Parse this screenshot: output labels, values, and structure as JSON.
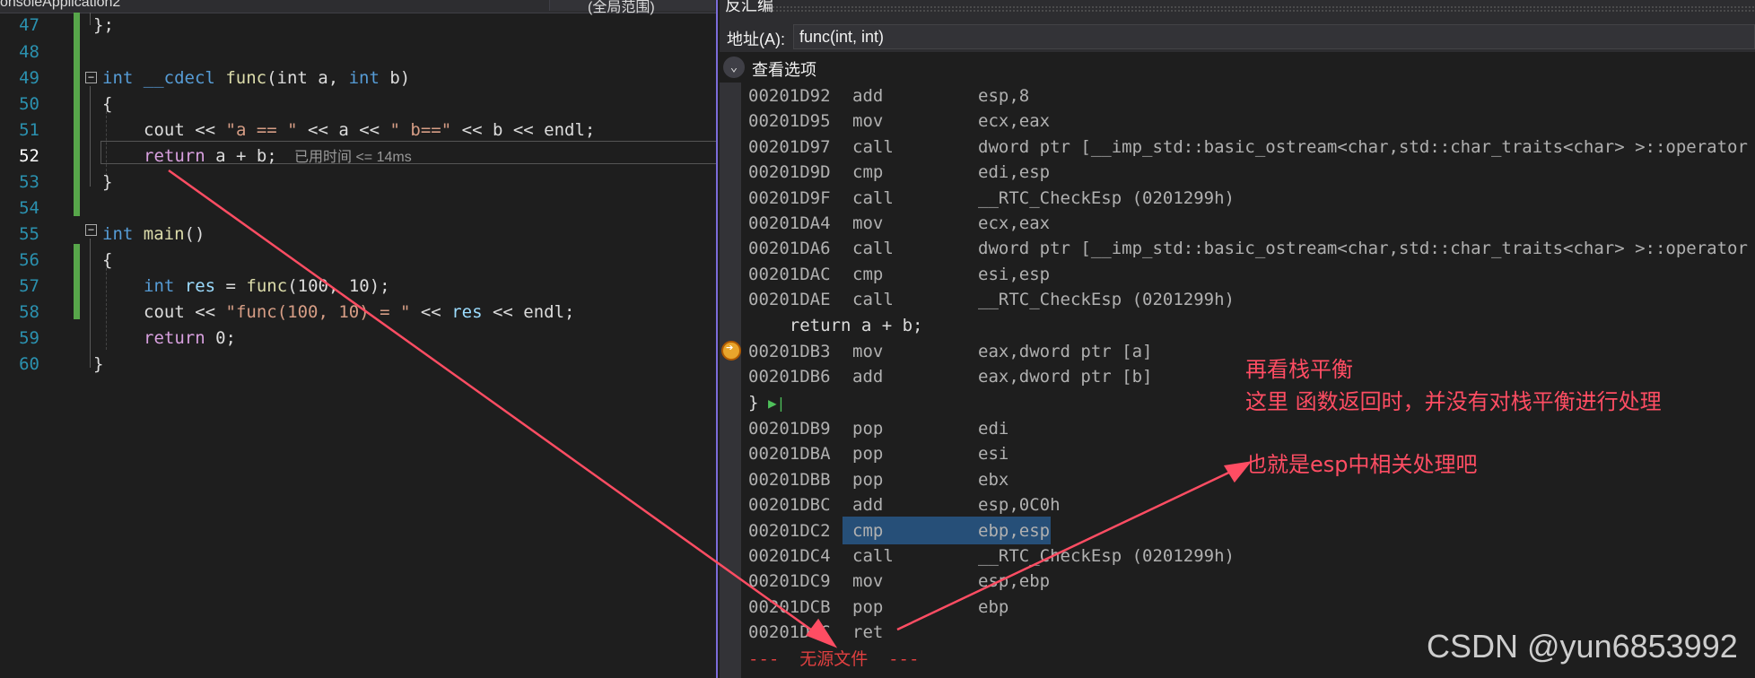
{
  "editor": {
    "tab_title": "onsoleApplication2",
    "scope_combo": "(全局范围)",
    "line_numbers": [
      "47",
      "48",
      "49",
      "50",
      "51",
      "52",
      "53",
      "54",
      "55",
      "56",
      "57",
      "58",
      "59",
      "60"
    ],
    "elapsed": "已用时间 <= 14ms",
    "code": {
      "l47": "};",
      "l49_kw": "int",
      "l49_cdecl": "__cdecl",
      "l49_fn": "func",
      "l49_params_a": "(int a, ",
      "l49_kw2": "int",
      "l49_tail": " b)",
      "l50": "{",
      "l51_a": "cout << ",
      "l51_s1": "\"a == \"",
      "l51_b": " << a << ",
      "l51_s2": "\" b==\"",
      "l51_c": " << b << endl;",
      "l52_ret": "return",
      "l52_rest": " a + b;",
      "l53": "}",
      "l55_kw": "int",
      "l55_fn": "main",
      "l55_tail": "()",
      "l56": "{",
      "l57_kw": "int",
      "l57_var": " res",
      "l57_eq": " = ",
      "l57_fn": "func",
      "l57_args": "(100, 10);",
      "l58_a": "cout << ",
      "l58_s": "\"func(100, 10) = \"",
      "l58_b": " << ",
      "l58_var": "res",
      "l58_c": " << endl;",
      "l59_ret": "return",
      "l59_rest": " 0;",
      "l60": "}"
    }
  },
  "disassembly": {
    "title": "反汇编",
    "address_label": "地址(A):",
    "address_value": "func(int, int)",
    "view_options": "查看选项",
    "rows1": [
      {
        "addr": "00201D92",
        "mn": "add",
        "op": "esp,8"
      },
      {
        "addr": "00201D95",
        "mn": "mov",
        "op": "ecx,eax"
      },
      {
        "addr": "00201D97",
        "mn": "call",
        "op": "dword ptr [__imp_std::basic_ostream<char,std::char_traits<char> >::operator"
      },
      {
        "addr": "00201D9D",
        "mn": "cmp",
        "op": "edi,esp"
      },
      {
        "addr": "00201D9F",
        "mn": "call",
        "op": "__RTC_CheckEsp (0201299h)"
      },
      {
        "addr": "00201DA4",
        "mn": "mov",
        "op": "ecx,eax"
      },
      {
        "addr": "00201DA6",
        "mn": "call",
        "op": "dword ptr [__imp_std::basic_ostream<char,std::char_traits<char> >::operator"
      },
      {
        "addr": "00201DAC",
        "mn": "cmp",
        "op": "esi,esp"
      },
      {
        "addr": "00201DAE",
        "mn": "call",
        "op": "__RTC_CheckEsp (0201299h)"
      }
    ],
    "source_return": "    return a + b;",
    "rows2": [
      {
        "addr": "00201DB3",
        "mn": "mov",
        "op": "eax,dword ptr [a]"
      },
      {
        "addr": "00201DB6",
        "mn": "add",
        "op": "eax,dword ptr [b]"
      }
    ],
    "source_brace": "}",
    "step_icon": "run-to-cursor-icon",
    "rows3": [
      {
        "addr": "00201DB9",
        "mn": "pop",
        "op": "edi"
      },
      {
        "addr": "00201DBA",
        "mn": "pop",
        "op": "esi"
      },
      {
        "addr": "00201DBB",
        "mn": "pop",
        "op": "ebx"
      },
      {
        "addr": "00201DBC",
        "mn": "add",
        "op": "esp,0C0h"
      },
      {
        "addr": "00201DC2",
        "mn": "cmp",
        "op": "ebp,esp"
      },
      {
        "addr": "00201DC4",
        "mn": "call",
        "op": "__RTC_CheckEsp (0201299h)"
      },
      {
        "addr": "00201DC9",
        "mn": "mov",
        "op": "esp,ebp"
      },
      {
        "addr": "00201DCB",
        "mn": "pop",
        "op": "ebp"
      },
      {
        "addr": "00201DCC",
        "mn": "ret",
        "op": ""
      }
    ],
    "no_source": "---  无源文件  ---"
  },
  "annotations": {
    "line1": "再看栈平衡",
    "line2": "这里 函数返回时，并没有对栈平衡进行处理",
    "line3": "也就是esp中相关处理吧"
  },
  "watermark": "CSDN @yun6853992",
  "colors": {
    "annotation": "#ff4d63",
    "keyword": "#569cd6",
    "selection": "#264f78",
    "change_bar": "#57a64a"
  }
}
